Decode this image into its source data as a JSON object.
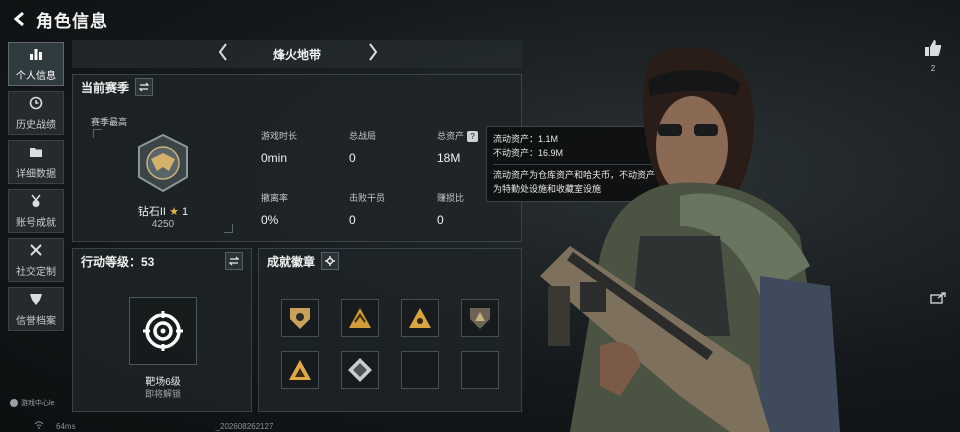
{
  "header": {
    "back_icon": "back-arrow-icon",
    "title": "角色信息"
  },
  "sidebar": {
    "items": [
      {
        "label": "个人信息",
        "icon": "bar-chart-icon",
        "active": true
      },
      {
        "label": "历史战绩",
        "icon": "clock-icon",
        "active": false
      },
      {
        "label": "详细数据",
        "icon": "folder-icon",
        "active": false
      },
      {
        "label": "账号成就",
        "icon": "medal-icon",
        "active": false
      },
      {
        "label": "社交定制",
        "icon": "tools-icon",
        "active": false
      },
      {
        "label": "信誉档案",
        "icon": "shield-icon",
        "active": false
      }
    ],
    "footer_text": "游戏中心le"
  },
  "mode_selector": {
    "title": "烽火地带"
  },
  "season": {
    "heading": "当前赛季",
    "best_label": "赛季最高",
    "rank_name": "钻石II",
    "rank_stars": "★",
    "rank_star_count": "1",
    "rank_score": "4250",
    "stats": [
      {
        "label": "游戏时长",
        "value": "0min"
      },
      {
        "label": "总战局",
        "value": "0"
      },
      {
        "label": "总资产",
        "value": "18M"
      },
      {
        "label": "撤离率",
        "value": "0%"
      },
      {
        "label": "击败干员",
        "value": "0"
      },
      {
        "label": "赚损比",
        "value": "0"
      }
    ]
  },
  "tooltip": {
    "line1": "流动资产：1.1M",
    "line2": "不动资产：16.9M",
    "desc1": "流动资产为仓库资产和哈夫币，不动资产",
    "desc2": "为特勤处设施和收藏室设施"
  },
  "level": {
    "heading": "行动等级：53",
    "name": "靶场6级",
    "status": "即将解锁"
  },
  "badges": {
    "heading": "成就徽章",
    "count_filled": 6,
    "count_empty": 2
  },
  "right_panel": {
    "like_count": "2"
  },
  "bottom_bar": {
    "ping": "64ms",
    "id_text": "_202608262127"
  },
  "colors": {
    "accent_gold": "#e2b64a",
    "panel_bg": "#1e2427",
    "border": "#394246"
  }
}
